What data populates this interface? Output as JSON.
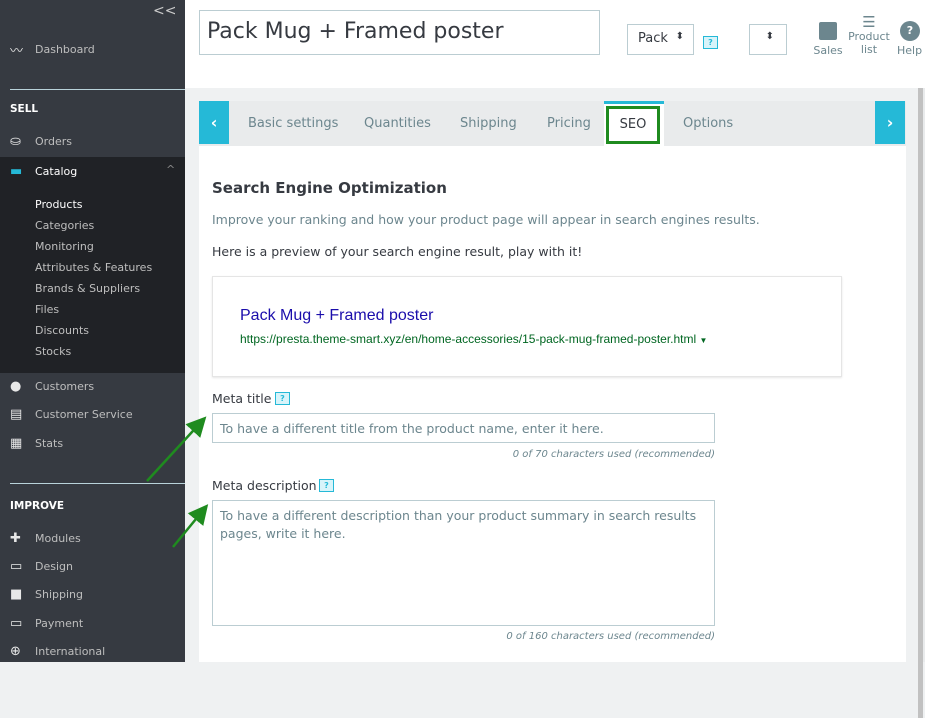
{
  "sidebar": {
    "collapse": "<<",
    "dashboard": "Dashboard",
    "sell": "SELL",
    "orders": "Orders",
    "catalog": "Catalog",
    "catalog_items": [
      "Products",
      "Categories",
      "Monitoring",
      "Attributes & Features",
      "Brands & Suppliers",
      "Files",
      "Discounts",
      "Stocks"
    ],
    "customers": "Customers",
    "customer_service": "Customer Service",
    "stats": "Stats",
    "improve": "IMPROVE",
    "improve_items": [
      "Modules",
      "Design",
      "Shipping",
      "Payment",
      "International"
    ]
  },
  "header": {
    "product_name": "Pack Mug + Framed poster",
    "type_select": "Pack",
    "help_badge": "?",
    "toolbar": {
      "sales": "Sales",
      "product_list": "Product list",
      "help": "Help"
    }
  },
  "tabs": [
    "Basic settings",
    "Quantities",
    "Shipping",
    "Pricing",
    "SEO",
    "Options"
  ],
  "active_tab": "SEO",
  "seo": {
    "heading": "Search Engine Optimization",
    "intro": "Improve your ranking and how your product page will appear in search engines results.",
    "preview_intro": "Here is a preview of your search engine result, play with it!",
    "preview_title": "Pack Mug + Framed poster",
    "preview_url": "https://presta.theme-smart.xyz/en/home-accessories/15-pack-mug-framed-poster.html",
    "meta_title_label": "Meta title",
    "meta_title_placeholder": "To have a different title from the product name, enter it here.",
    "meta_title_count": "0 of 70 characters used (recommended)",
    "meta_desc_label": "Meta description",
    "meta_desc_placeholder": "To have a different description than your product summary in search results pages, write it here.",
    "meta_desc_count": "0 of 160 characters used (recommended)"
  },
  "colors": {
    "accent": "#25b9d7",
    "annotation": "#1f8b1f",
    "sidebar": "#363a41"
  }
}
